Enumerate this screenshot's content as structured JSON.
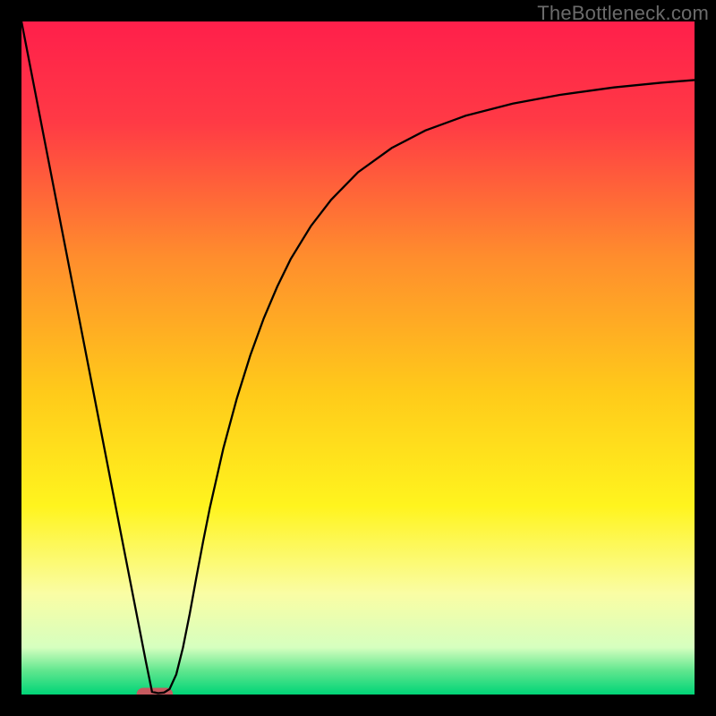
{
  "watermark": {
    "text": "TheBottleneck.com"
  },
  "chart_data": {
    "type": "line",
    "title": "",
    "xlabel": "",
    "ylabel": "",
    "xlim": [
      0,
      100
    ],
    "ylim": [
      0,
      100
    ],
    "grid": false,
    "legend": false,
    "background_gradient": {
      "stops": [
        {
          "offset": 0.0,
          "color": "#ff1f4b"
        },
        {
          "offset": 0.15,
          "color": "#ff3a45"
        },
        {
          "offset": 0.35,
          "color": "#ff8d2d"
        },
        {
          "offset": 0.55,
          "color": "#ffca1a"
        },
        {
          "offset": 0.72,
          "color": "#fff41e"
        },
        {
          "offset": 0.85,
          "color": "#fafda4"
        },
        {
          "offset": 0.93,
          "color": "#d6ffbf"
        },
        {
          "offset": 0.965,
          "color": "#5fe68e"
        },
        {
          "offset": 1.0,
          "color": "#00d477"
        }
      ]
    },
    "series": [
      {
        "name": "bottleneck-curve",
        "color": "#000000",
        "stroke_width": 2.3,
        "x": [
          0,
          2,
          4,
          6,
          8,
          10,
          12,
          14,
          15.5,
          17,
          18.5,
          19.4,
          20.3,
          21.2,
          22,
          23,
          24,
          25,
          26,
          27,
          28,
          30,
          32,
          34,
          36,
          38,
          40,
          43,
          46,
          50,
          55,
          60,
          66,
          73,
          80,
          88,
          95,
          100
        ],
        "y": [
          100,
          89.7,
          79.4,
          69.1,
          58.8,
          48.5,
          38.2,
          27.9,
          20.2,
          12.5,
          4.8,
          0.4,
          0.2,
          0.3,
          0.8,
          3.0,
          7.0,
          12.0,
          17.5,
          22.8,
          27.8,
          36.6,
          44.0,
          50.4,
          55.9,
          60.6,
          64.7,
          69.6,
          73.5,
          77.6,
          81.2,
          83.8,
          86.0,
          87.8,
          89.1,
          90.2,
          90.9,
          91.3
        ]
      }
    ],
    "markers": [
      {
        "name": "minimum-marker",
        "shape": "rounded-rect",
        "x": 19.8,
        "y": 0.0,
        "width": 5.4,
        "height": 2.0,
        "fill": "#c65a5f"
      }
    ]
  }
}
